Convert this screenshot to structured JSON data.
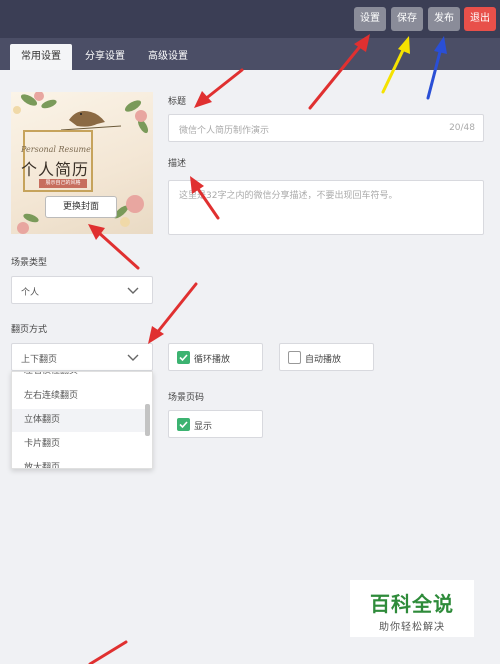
{
  "header": {
    "buttons": {
      "settings": "设置",
      "save": "保存",
      "publish": "发布",
      "exit": "退出"
    }
  },
  "tabs": [
    "常用设置",
    "分享设置",
    "高级设置"
  ],
  "cover": {
    "english": "Personal Resume",
    "title": "个人简历",
    "subtitle": "展示自己的风格",
    "change_button": "更换封面"
  },
  "form": {
    "title_label": "标题",
    "title_placeholder": "微信个人简历制作演示",
    "title_count": "20/48",
    "desc_label": "描述",
    "desc_placeholder": "这里是32字之内的微信分享描述，不要出现回车符号。",
    "scene_type_label": "场景类型",
    "scene_type_value": "个人",
    "page_mode_label": "翻页方式",
    "page_mode_value": "上下翻页",
    "loop_label": "循环播放",
    "auto_label": "自动播放",
    "page_number_label": "场景页码",
    "show_label": "显示"
  },
  "dropdown_options": [
    "左右惯性翻页",
    "左右连续翻页",
    "立体翻页",
    "卡片翻页",
    "放大翻页"
  ],
  "watermark": {
    "title": "百科全说",
    "subtitle": "助你轻松解决"
  },
  "colors": {
    "topbar": "#3b3e55",
    "tabbar": "#4b4e66",
    "exit_button": "#e8504a",
    "checkbox_on": "#3cb371",
    "arrow_red": "#e03030",
    "arrow_yellow": "#f5e200",
    "arrow_blue": "#2a4fd6"
  }
}
